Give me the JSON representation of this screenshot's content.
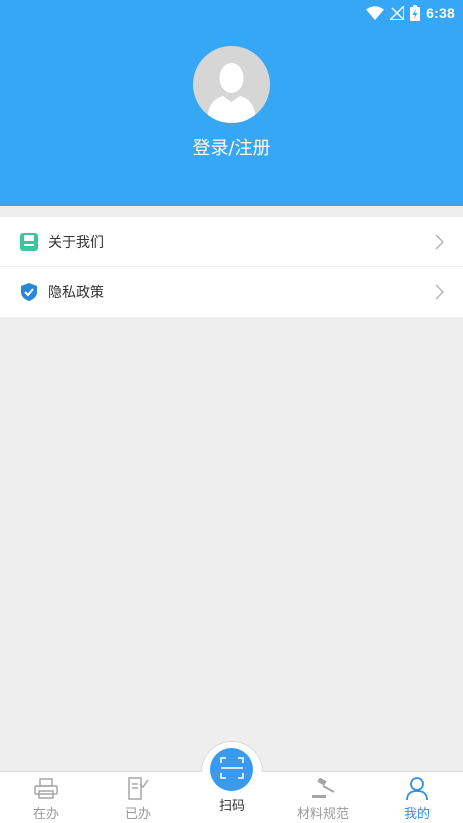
{
  "status": {
    "time": "6:38",
    "wifi_icon": "wifi-icon",
    "signal_icon": "no-signal-icon",
    "battery_icon": "battery-charging-icon"
  },
  "header": {
    "login_label": "登录/注册",
    "avatar_icon": "default-avatar-icon"
  },
  "menu": {
    "items": [
      {
        "label": "关于我们",
        "icon": "about-us-icon"
      },
      {
        "label": "隐私政策",
        "icon": "shield-check-icon"
      }
    ]
  },
  "tabbar": {
    "tabs": [
      {
        "label": "在办",
        "icon": "printer-icon"
      },
      {
        "label": "已办",
        "icon": "document-check-icon"
      },
      {
        "label": "扫码",
        "icon": "scan-icon"
      },
      {
        "label": "材料规范",
        "icon": "gavel-icon"
      },
      {
        "label": "我的",
        "icon": "user-icon"
      }
    ],
    "active": "我的"
  },
  "colors": {
    "header": "#36a7f5",
    "active_tab": "#2f8ee8",
    "background": "#eeeeee"
  }
}
